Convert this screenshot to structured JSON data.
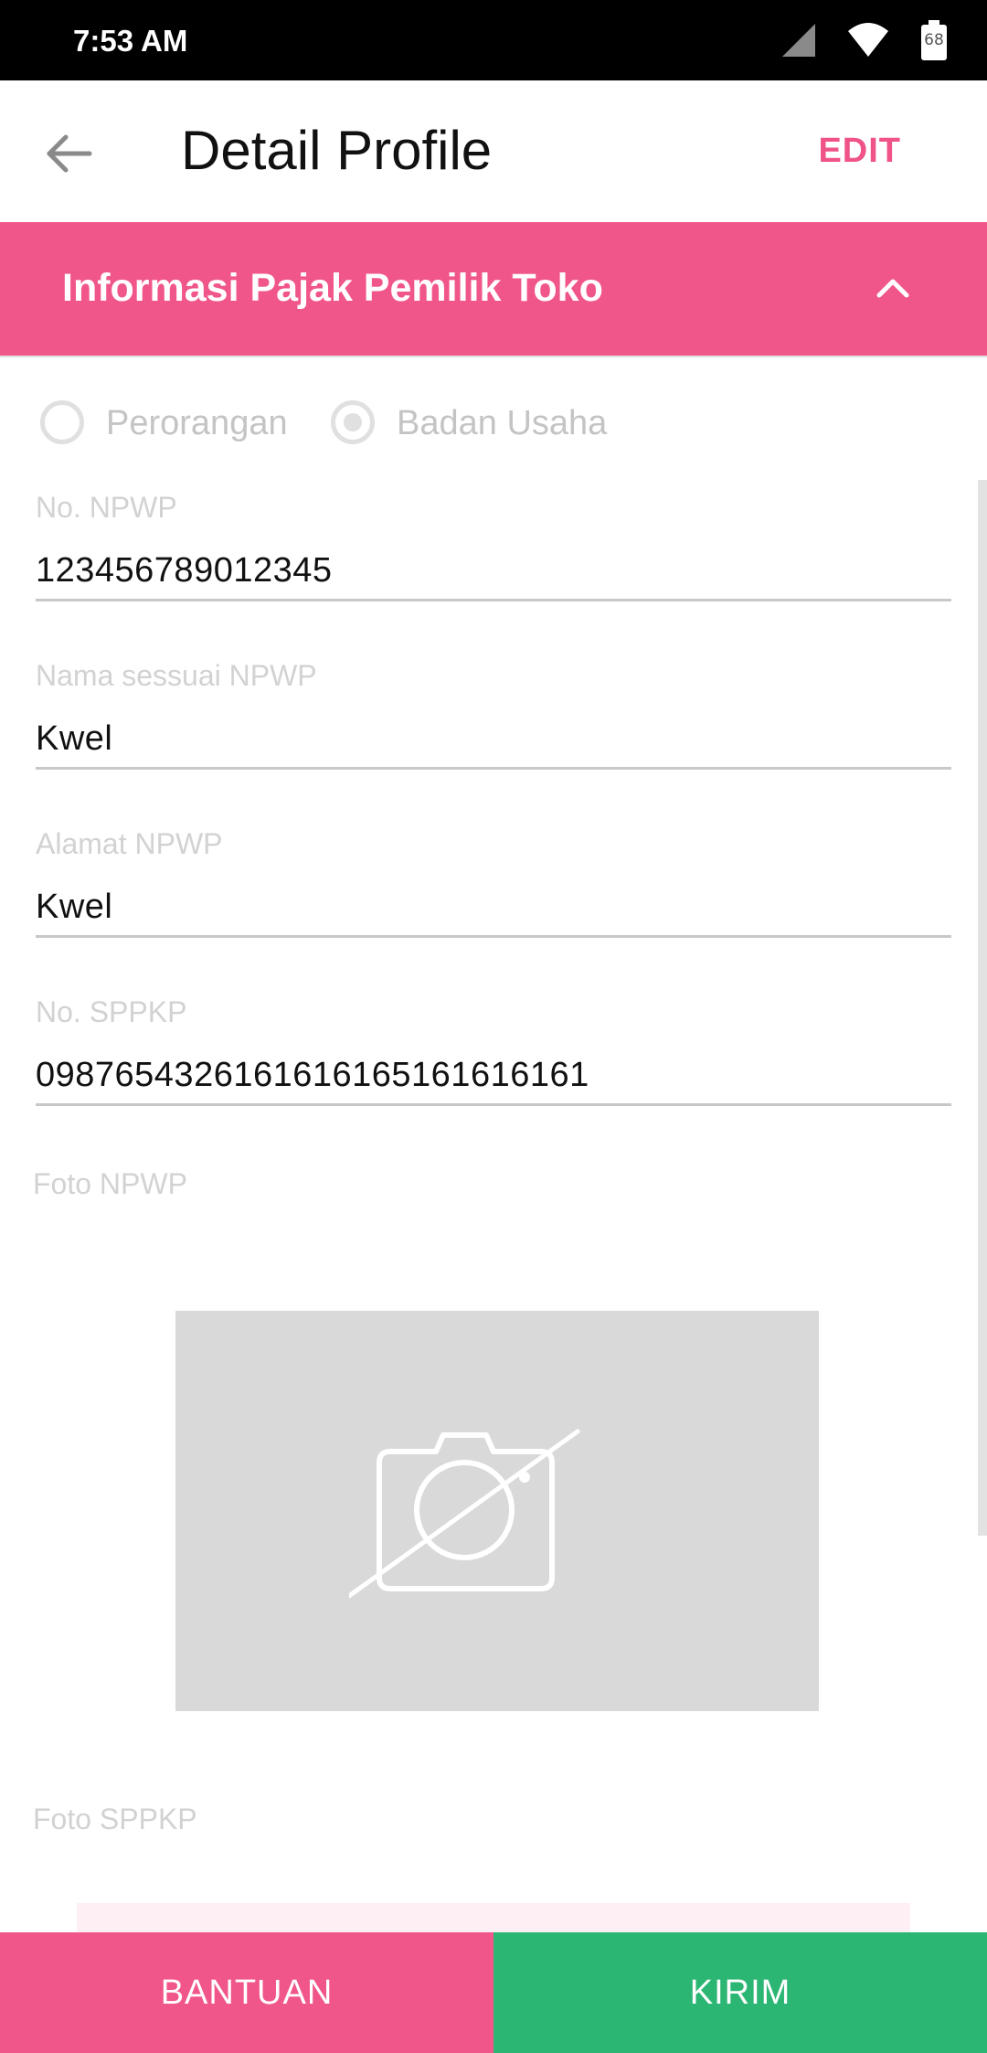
{
  "status_bar": {
    "time": "7:53 AM",
    "battery_level": "68",
    "icons": [
      "signal-icon",
      "wifi-icon",
      "battery-icon"
    ]
  },
  "app_bar": {
    "title": "Detail Profile",
    "edit_label": "EDIT"
  },
  "section": {
    "title": "Informasi Pajak Pemilik Toko",
    "expanded": true
  },
  "tax_type": {
    "options": [
      "Perorangan",
      "Badan Usaha"
    ],
    "selected": "Badan Usaha"
  },
  "fields": [
    {
      "label": "No. NPWP",
      "value": "123456789012345"
    },
    {
      "label": "Nama sessuai NPWP",
      "value": "Kwel"
    },
    {
      "label": "Alamat NPWP",
      "value": "Kwel"
    },
    {
      "label": "No. SPPKP",
      "value": "0987654326161616165161616161"
    }
  ],
  "photos": {
    "npwp_label": "Foto NPWP",
    "sppkp_label": "Foto SPPKP",
    "placeholder_icon": "no-camera-icon"
  },
  "bottom": {
    "help_label": "BANTUAN",
    "submit_label": "KIRIM"
  },
  "colors": {
    "primary_pink": "#f0568a",
    "edit_pink": "#ef5388",
    "submit_green": "#2bb673"
  }
}
